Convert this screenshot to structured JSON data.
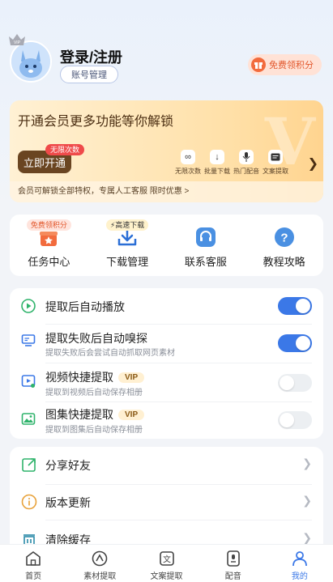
{
  "header": {
    "login_title": "登录/注册",
    "account_button": "账号管理",
    "free_points": "免费领积分",
    "avatar_badge": "VIP"
  },
  "vip_card": {
    "title": "开通会员更多功能等你解锁",
    "open_button": "立即开通",
    "unlimited_badge": "无限次数",
    "watermark": "V",
    "features": [
      {
        "label": "无限次数",
        "icon": "infinity-icon"
      },
      {
        "label": "批量下载",
        "icon": "download-icon"
      },
      {
        "label": "热门配音",
        "icon": "microphone-icon"
      },
      {
        "label": "文案提取",
        "icon": "document-icon"
      }
    ],
    "bottom_text": "会员可解锁全部特权，专属人工客服 限时优惠 >"
  },
  "quick_grid": [
    {
      "label": "任务中心",
      "badge": "免费领积分",
      "icon": "task-gift-icon"
    },
    {
      "label": "下载管理",
      "badge": "⚡高速下载",
      "icon": "download-tray-icon"
    },
    {
      "label": "联系客服",
      "badge": "",
      "icon": "headset-icon"
    },
    {
      "label": "教程攻略",
      "badge": "",
      "icon": "help-icon"
    }
  ],
  "settings": [
    {
      "label": "提取后自动播放",
      "sub": "",
      "vip": false,
      "on": true,
      "icon": "play-circle-icon"
    },
    {
      "label": "提取失败后自动嗅探",
      "sub": "提取失败后会尝试自动抓取网页素材",
      "vip": false,
      "on": true,
      "icon": "monitor-icon"
    },
    {
      "label": "视频快捷提取",
      "sub": "提取到视频后自动保存相册",
      "vip": true,
      "on": false,
      "icon": "video-icon"
    },
    {
      "label": "图集快捷提取",
      "sub": "提取到图集后自动保存相册",
      "vip": true,
      "on": false,
      "icon": "image-icon"
    }
  ],
  "vip_tag": "VIP",
  "menu": [
    {
      "label": "分享好友",
      "icon": "share-icon"
    },
    {
      "label": "版本更新",
      "icon": "info-icon"
    },
    {
      "label": "清除缓存",
      "icon": "clear-cache-icon"
    }
  ],
  "tabs": [
    {
      "label": "首页",
      "icon": "home-icon",
      "active": false
    },
    {
      "label": "素材提取",
      "icon": "extract-icon",
      "active": false
    },
    {
      "label": "文案提取",
      "icon": "text-icon",
      "active": false
    },
    {
      "label": "配音",
      "icon": "voice-icon",
      "active": false
    },
    {
      "label": "我的",
      "icon": "user-icon",
      "active": true
    }
  ],
  "colors": {
    "accent": "#3b78e7",
    "vip_gold": "#6a4521",
    "red_badge": "#ef4a4a"
  }
}
